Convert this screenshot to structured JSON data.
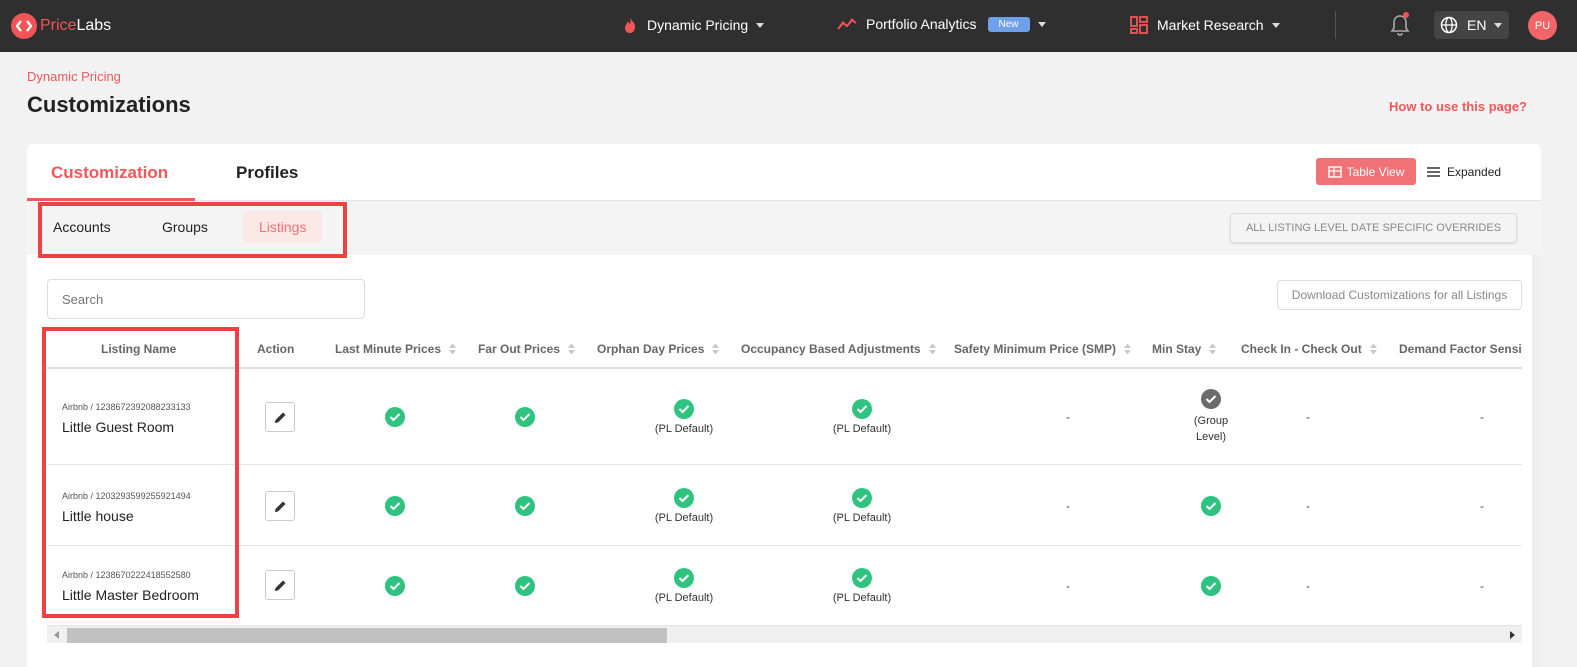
{
  "brand": {
    "part1": "Price",
    "part2": "Labs"
  },
  "nav": {
    "dynamic_pricing": "Dynamic Pricing",
    "portfolio_analytics": "Portfolio Analytics",
    "new_badge": "New",
    "market_research": "Market Research",
    "language": "EN",
    "avatar_initials": "PU"
  },
  "breadcrumb": "Dynamic Pricing",
  "page_title": "Customizations",
  "how_to": "How to use this page?",
  "tabs": {
    "customization": "Customization",
    "profiles": "Profiles"
  },
  "view": {
    "table": "Table View",
    "expanded": "Expanded"
  },
  "subtabs": {
    "accounts": "Accounts",
    "groups": "Groups",
    "listings": "Listings"
  },
  "overrides_button": "ALL LISTING LEVEL DATE SPECIFIC OVERRIDES",
  "search_placeholder": "Search",
  "download_button": "Download Customizations for all Listings",
  "columns": {
    "listing_name": "Listing Name",
    "action": "Action",
    "last_minute": "Last Minute Prices",
    "far_out": "Far Out Prices",
    "orphan_day": "Orphan Day Prices",
    "occupancy": "Occupancy Based Adjustments",
    "smp": "Safety Minimum Price (SMP)",
    "min_stay": "Min Stay",
    "checkin": "Check In - Check Out",
    "demand": "Demand Factor Sensiti"
  },
  "rows": [
    {
      "source": "Airbnb / 1238672392088233133",
      "name": "Little Guest Room",
      "pl_default": "(PL Default)",
      "smp": "-",
      "min_stay_note": "(Group Level)",
      "checkin": "-",
      "demand": "-"
    },
    {
      "source": "Airbnb / 1203293599255921494",
      "name": "Little house",
      "pl_default": "(PL Default)",
      "smp": "-",
      "checkin": "-",
      "demand": "-"
    },
    {
      "source": "Airbnb / 1238670222418552580",
      "name": "Little Master Bedroom",
      "pl_default": "(PL Default)",
      "smp": "-",
      "checkin": "-",
      "demand": "-"
    }
  ],
  "colors": {
    "accent": "#f0585a",
    "topbar": "#2f2f2f",
    "check": "#2fc37f",
    "highlight": "#ee4144"
  }
}
